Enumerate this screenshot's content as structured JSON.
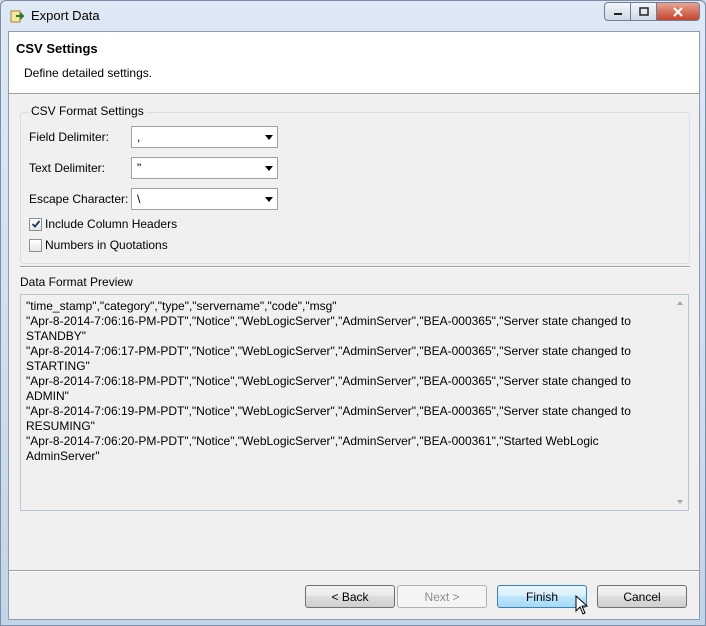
{
  "window": {
    "title": "Export Data",
    "icons": {
      "app": "export-data-icon",
      "minimize": "minimize-icon",
      "maximize": "maximize-icon",
      "close": "close-icon"
    }
  },
  "header": {
    "title": "CSV Settings",
    "description": "Define detailed settings."
  },
  "csv_format": {
    "group_label": "CSV Format Settings",
    "field_delimiter": {
      "label": "Field Delimiter:",
      "value": ","
    },
    "text_delimiter": {
      "label": "Text Delimiter:",
      "value": "\""
    },
    "escape_character": {
      "label": "Escape Character:",
      "value": "\\"
    },
    "include_headers": {
      "label": "Include Column Headers",
      "checked": true
    },
    "numbers_in_quotes": {
      "label": "Numbers in Quotations",
      "checked": false
    }
  },
  "preview": {
    "label": "Data Format Preview",
    "lines": [
      "\"time_stamp\",\"category\",\"type\",\"servername\",\"code\",\"msg\"",
      "\"Apr-8-2014-7:06:16-PM-PDT\",\"Notice\",\"WebLogicServer\",\"AdminServer\",\"BEA-000365\",\"Server state changed to STANDBY\"",
      "\"Apr-8-2014-7:06:17-PM-PDT\",\"Notice\",\"WebLogicServer\",\"AdminServer\",\"BEA-000365\",\"Server state changed to STARTING\"",
      "\"Apr-8-2014-7:06:18-PM-PDT\",\"Notice\",\"WebLogicServer\",\"AdminServer\",\"BEA-000365\",\"Server state changed to ADMIN\"",
      "\"Apr-8-2014-7:06:19-PM-PDT\",\"Notice\",\"WebLogicServer\",\"AdminServer\",\"BEA-000365\",\"Server state changed to RESUMING\"",
      "\"Apr-8-2014-7:06:20-PM-PDT\",\"Notice\",\"WebLogicServer\",\"AdminServer\",\"BEA-000361\",\"Started WebLogic AdminServer\""
    ]
  },
  "buttons": {
    "back": "< Back",
    "next": "Next >",
    "finish": "Finish",
    "cancel": "Cancel"
  },
  "colors": {
    "accent": "#3c7fb1",
    "close_button": "#c5442c"
  }
}
